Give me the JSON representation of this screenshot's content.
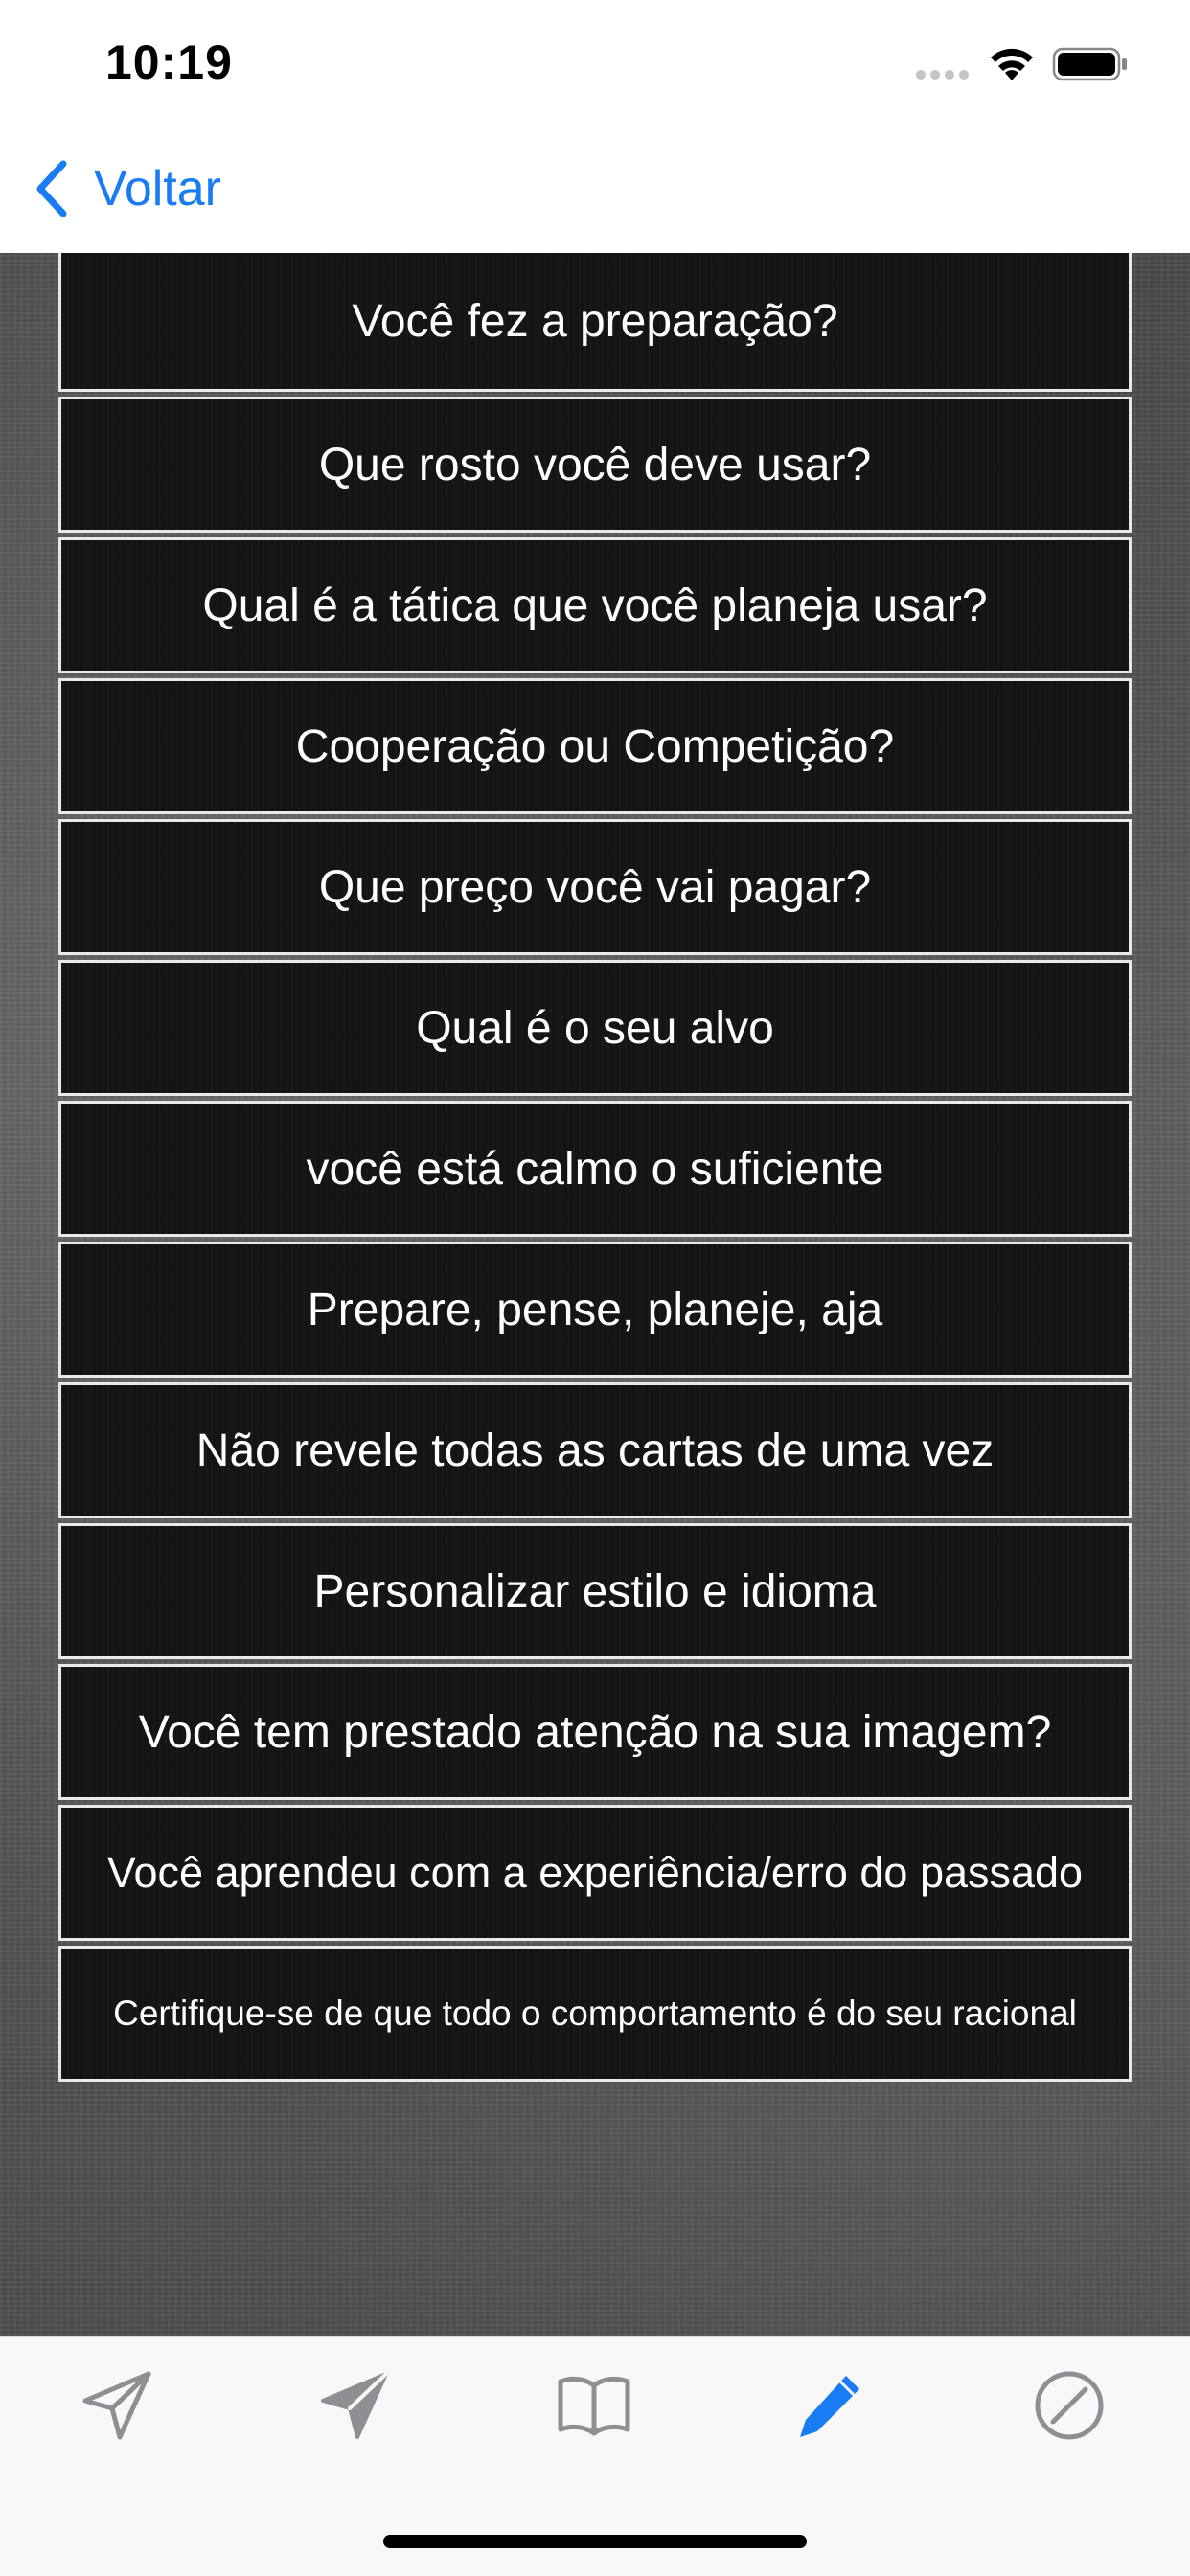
{
  "status_bar": {
    "time": "10:19"
  },
  "nav": {
    "back_label": "Voltar"
  },
  "colors": {
    "accent": "#1a7cf5",
    "tab_inactive": "#8e8e93",
    "row_background": "#141414",
    "row_border": "#e9e9e9"
  },
  "items": [
    {
      "label": "Você fez a preparação?"
    },
    {
      "label": "Que rosto você deve usar?"
    },
    {
      "label": "Qual é a tática que você planeja usar?"
    },
    {
      "label": "Cooperação ou Competição?"
    },
    {
      "label": "Que preço você vai pagar?"
    },
    {
      "label": "Qual é o seu alvo"
    },
    {
      "label": "você está calmo o suficiente"
    },
    {
      "label": "Prepare, pense, planeje, aja"
    },
    {
      "label": "Não revele todas as cartas de uma vez"
    },
    {
      "label": "Personalizar estilo e idioma"
    },
    {
      "label": "Você tem prestado atenção na sua imagem?"
    },
    {
      "label": "Você aprendeu com a experiência/erro do passado"
    },
    {
      "label": "Certifique-se de que todo o comportamento é do seu racional"
    }
  ],
  "tab_bar": {
    "tabs": [
      {
        "icon": "send-outline-icon",
        "active": false
      },
      {
        "icon": "send-filled-icon",
        "active": false
      },
      {
        "icon": "book-icon",
        "active": false
      },
      {
        "icon": "pencil-icon",
        "active": true
      },
      {
        "icon": "compass-icon",
        "active": false
      }
    ]
  }
}
